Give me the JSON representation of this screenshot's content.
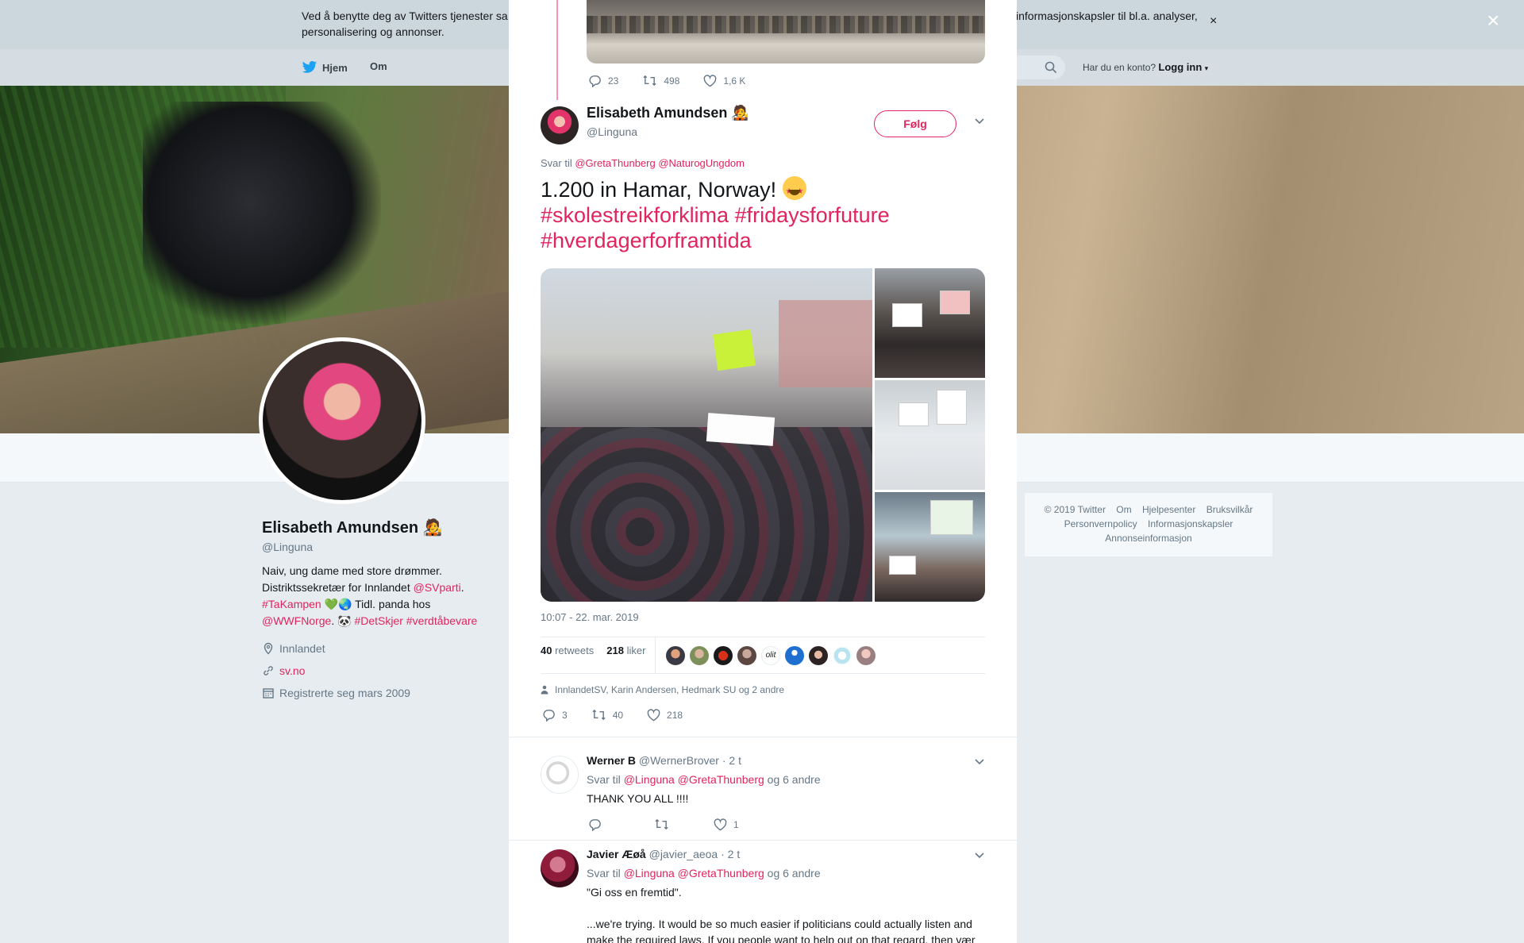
{
  "cookie": {
    "text": "Ved å benytte deg av Twitters tjenester sa",
    "text_right": "informasjonskapsler til bl.a. analyser,",
    "text_line2": "personalisering og annonser.",
    "close": "×"
  },
  "nav": {
    "home": "Hjem",
    "about": "Om",
    "login_prompt": "Har du en konto?",
    "login": "Logg inn"
  },
  "profile": {
    "name": "Elisabeth Amundsen 🧑‍🎤",
    "handle": "@Linguna",
    "bio_1": "Naiv, ung dame med store drømmer.",
    "bio_2": "Distriktssekretær for Innlandet",
    "bio_2_link": "@SVparti",
    "bio_2_end": ".",
    "bio_3_link": "#TaKampen",
    "bio_3_emoji": "💚🌏",
    "bio_3_text": "Tidl. panda hos",
    "bio_4_link1": "@WWFNorge",
    "bio_4_text": ". 🐼",
    "bio_4_link2": "#DetSkjer #verdtåbevare",
    "location": "Innlandet",
    "website": "sv.no",
    "joined": "Registrerte seg mars 2009"
  },
  "footer": {
    "items_row1": [
      "© 2019 Twitter",
      "Om",
      "Hjelpesenter",
      "Bruksvilkår"
    ],
    "items_row2": [
      "Personvernpolicy",
      "Informasjonskapsler"
    ],
    "items_row3": [
      "Annonseinformasjon"
    ]
  },
  "overlay_close": "×",
  "previous_tweet": {
    "replies": "23",
    "retweets": "498",
    "likes": "1,6 K"
  },
  "tweet": {
    "author_name": "Elisabeth Amundsen 🧑‍🎤",
    "author_handle": "@Linguna",
    "follow": "Følg",
    "reply_prefix": "Svar til",
    "reply_mentions": "@GretaThunberg @NaturogUngdom",
    "text": "1.200 in Hamar, Norway!",
    "hashtags_1": "#skolestreikforklima #fridaysforfuture",
    "hashtags_2": "#hverdagerforframtida",
    "timestamp": "10:07 - 22. mar. 2019",
    "retweets_count": "40",
    "retweets_label": "retweets",
    "likes_count": "218",
    "likes_label": "liker",
    "social_context": "InnlandetSV, Karin Andersen, Hedmark SU og 2 andre",
    "replies": "3",
    "retweets": "40",
    "likes": "218"
  },
  "replies": [
    {
      "name": "Werner B",
      "handle": "@WernerBrover",
      "time": "· 2 t",
      "reply_prefix": "Svar til",
      "mentions": "@Linguna @GretaThunberg",
      "others": "og 6 andre",
      "text": "THANK YOU ALL !!!!",
      "likes": "1"
    },
    {
      "name": "Javier Æøå",
      "handle": "@javier_aeoa",
      "time": "· 2 t",
      "reply_prefix": "Svar til",
      "mentions": "@Linguna @GretaThunberg",
      "others": "og 6 andre",
      "text_1": "\"Gi oss en fremtid\".",
      "text_2": "...we're trying. It would be so much easier if politicians could actually listen and",
      "text_3": "make the required laws. If you people want to help out on that regard, then vær"
    }
  ],
  "colors": {
    "accent": "#e0245e",
    "link_blue": "#1da1f2",
    "muted": "#657786"
  }
}
